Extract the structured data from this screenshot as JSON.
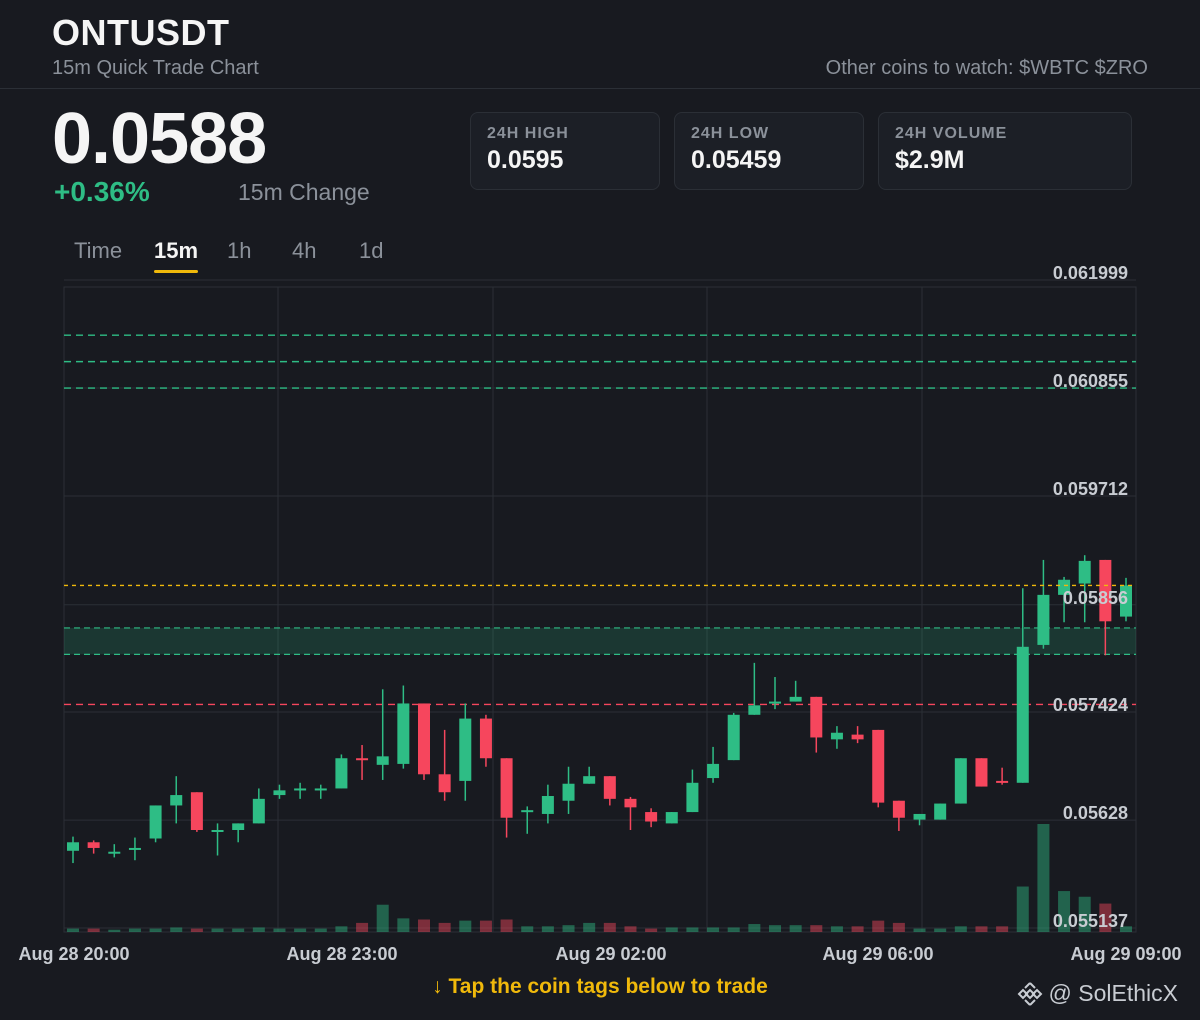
{
  "header": {
    "symbol": "ONTUSDT",
    "subtitle": "15m Quick Trade Chart",
    "watch": "Other coins to watch: $WBTC $ZRO"
  },
  "price": {
    "last": "0.0588",
    "change": "+0.36%",
    "change_label": "15m Change"
  },
  "stats": [
    {
      "label": "24H HIGH",
      "value": "0.0595"
    },
    {
      "label": "24H LOW",
      "value": "0.05459"
    },
    {
      "label": "24H VOLUME",
      "value": "$2.9M"
    }
  ],
  "tabs": [
    {
      "label": "Time",
      "active": false
    },
    {
      "label": "15m",
      "active": true
    },
    {
      "label": "1h",
      "active": false
    },
    {
      "label": "4h",
      "active": false
    },
    {
      "label": "1d",
      "active": false
    }
  ],
  "footer": {
    "cta": "↓ Tap the coin tags below to trade",
    "brand": "@ SolEthicX"
  },
  "colors": {
    "up": "#2ebd85",
    "down": "#f6465d",
    "accent": "#f0b90b",
    "background": "#181a20"
  },
  "chart_data": {
    "type": "candlestick",
    "y_ticks": [
      "0.061999",
      "0.060855",
      "0.059712",
      "0.05856",
      "0.057424",
      "0.05628",
      "0.055137"
    ],
    "ylim": [
      0.055137,
      0.061999
    ],
    "x_ticks": [
      "Aug 28 20:00",
      "Aug 28 23:00",
      "Aug 29 02:00",
      "Aug 29 06:00",
      "Aug 29 09:00"
    ],
    "grid": true,
    "current_price_line": 0.05868,
    "resistance_lines": [
      0.06133,
      0.06105,
      0.06077
    ],
    "support_zone": [
      0.05795,
      0.05823
    ],
    "support_line": 0.05841,
    "red_level_line": 0.05742,
    "candles": [
      [
        0.05587,
        0.05596,
        0.05574,
        0.05602
      ],
      [
        0.05596,
        0.0559,
        0.05584,
        0.05598
      ],
      [
        0.05586,
        0.05586,
        0.0558,
        0.05594
      ],
      [
        0.05588,
        0.0559,
        0.05577,
        0.05601
      ],
      [
        0.056,
        0.05635,
        0.05596,
        0.05635
      ],
      [
        0.05635,
        0.05646,
        0.05616,
        0.05666
      ],
      [
        0.05649,
        0.05609,
        0.05607,
        0.05649
      ],
      [
        0.05609,
        0.05609,
        0.05582,
        0.05616
      ],
      [
        0.05609,
        0.05616,
        0.05596,
        0.05616
      ],
      [
        0.05616,
        0.05642,
        0.05616,
        0.05653
      ],
      [
        0.05646,
        0.05651,
        0.05642,
        0.05657
      ],
      [
        0.05651,
        0.05653,
        0.05642,
        0.05659
      ],
      [
        0.05653,
        0.05653,
        0.05642,
        0.05657
      ],
      [
        0.05653,
        0.05685,
        0.05653,
        0.05689
      ],
      [
        0.05685,
        0.05683,
        0.05662,
        0.05699
      ],
      [
        0.05678,
        0.05687,
        0.05662,
        0.05758
      ],
      [
        0.05679,
        0.05743,
        0.05674,
        0.05762
      ],
      [
        0.05743,
        0.05668,
        0.05662,
        0.05743
      ],
      [
        0.05668,
        0.05649,
        0.0564,
        0.05715
      ],
      [
        0.05661,
        0.05727,
        0.0564,
        0.05743
      ],
      [
        0.05727,
        0.05685,
        0.05676,
        0.05731
      ],
      [
        0.05685,
        0.05622,
        0.05601,
        0.05685
      ],
      [
        0.05628,
        0.0563,
        0.05605,
        0.05634
      ],
      [
        0.05626,
        0.05645,
        0.05616,
        0.05657
      ],
      [
        0.0564,
        0.05658,
        0.05626,
        0.05676
      ],
      [
        0.05658,
        0.05666,
        0.05658,
        0.05676
      ],
      [
        0.05666,
        0.05642,
        0.05635,
        0.05666
      ],
      [
        0.05642,
        0.05633,
        0.05609,
        0.05644
      ],
      [
        0.05628,
        0.05618,
        0.05612,
        0.05632
      ],
      [
        0.05616,
        0.05628,
        0.05616,
        0.05628
      ],
      [
        0.05628,
        0.05659,
        0.05628,
        0.05673
      ],
      [
        0.05664,
        0.05679,
        0.05659,
        0.05697
      ],
      [
        0.05683,
        0.05731,
        0.05683,
        0.05733
      ],
      [
        0.05731,
        0.05741,
        0.05731,
        0.05786
      ],
      [
        0.05743,
        0.05745,
        0.05737,
        0.05771
      ],
      [
        0.05745,
        0.0575,
        0.05745,
        0.05767
      ],
      [
        0.0575,
        0.05707,
        0.05691,
        0.0575
      ],
      [
        0.05705,
        0.05712,
        0.05695,
        0.05719
      ],
      [
        0.0571,
        0.05705,
        0.05701,
        0.05719
      ],
      [
        0.05715,
        0.05638,
        0.05633,
        0.05715
      ],
      [
        0.0564,
        0.05622,
        0.05608,
        0.0564
      ],
      [
        0.0562,
        0.05626,
        0.05614,
        0.05626
      ],
      [
        0.0562,
        0.05637,
        0.0562,
        0.05637
      ],
      [
        0.05637,
        0.05685,
        0.05637,
        0.05685
      ],
      [
        0.05685,
        0.05655,
        0.05655,
        0.05685
      ],
      [
        0.05661,
        0.05659,
        0.05657,
        0.05675
      ],
      [
        0.05659,
        0.05803,
        0.05659,
        0.05865
      ],
      [
        0.05805,
        0.05858,
        0.05801,
        0.05895
      ],
      [
        0.05858,
        0.05874,
        0.05829,
        0.05877
      ],
      [
        0.0587,
        0.05894,
        0.05829,
        0.059
      ],
      [
        0.05895,
        0.0583,
        0.05794,
        0.05895
      ],
      [
        0.05835,
        0.05868,
        0.0583,
        0.05876
      ]
    ],
    "volume": [
      3,
      3,
      2,
      3,
      3,
      4,
      3,
      3,
      3,
      4,
      3,
      3,
      3,
      5,
      8,
      24,
      12,
      11,
      8,
      10,
      10,
      11,
      5,
      5,
      6,
      8,
      8,
      5,
      3,
      4,
      4,
      4,
      4,
      7,
      6,
      6,
      6,
      5,
      5,
      10,
      8,
      3,
      3,
      5,
      5,
      5,
      40,
      95,
      36,
      31,
      25,
      5
    ]
  }
}
